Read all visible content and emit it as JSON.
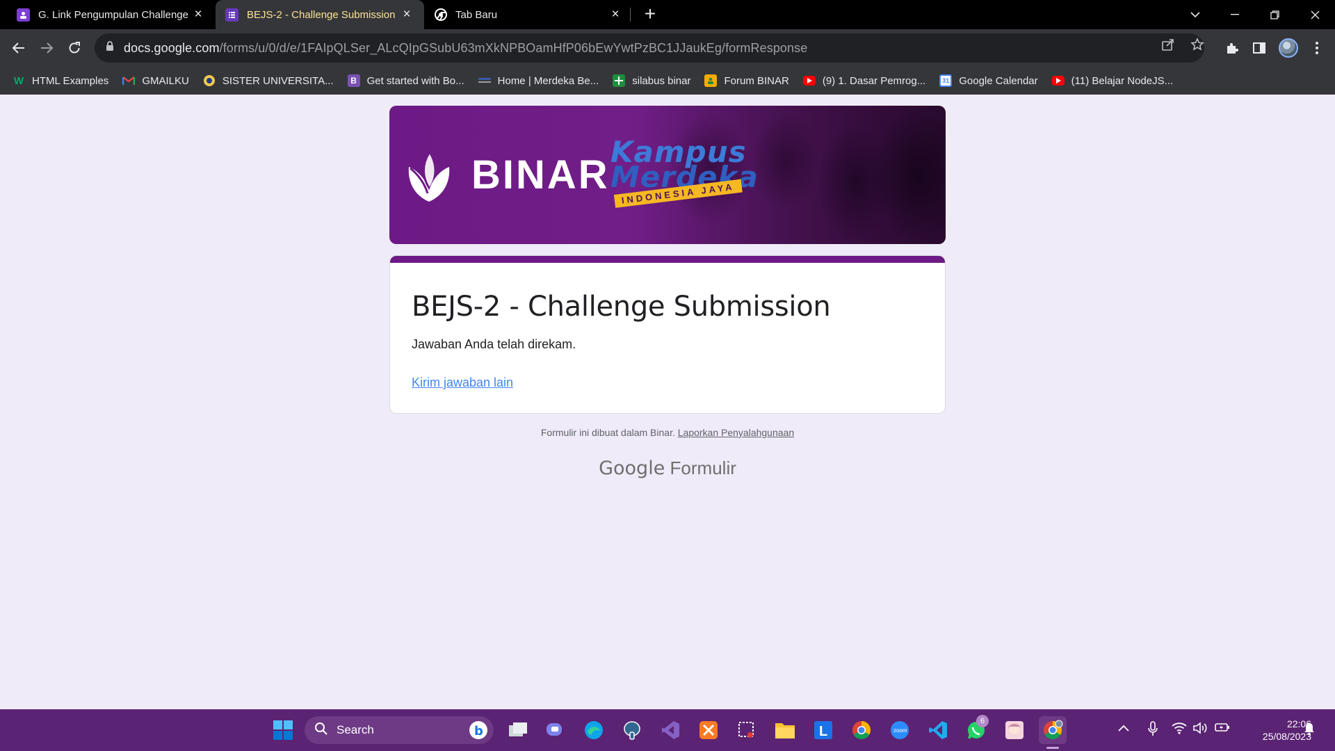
{
  "browser": {
    "tabs": [
      {
        "title": "G. Link Pengumpulan Challenge",
        "favicon": "classroom-icon",
        "color": "#7b3fd1"
      },
      {
        "title": "BEJS-2 - Challenge Submission",
        "favicon": "forms-icon",
        "color": "#673ab7",
        "active": true
      },
      {
        "title": "Tab Baru",
        "favicon": "chrome-icon",
        "color": "#ffffff"
      }
    ],
    "url_host": "docs.google.com",
    "url_path": "/forms/u/0/d/e/1FAIpQLSer_ALcQIpGSubU63mXkNPBOamHfP06bEwYwtPzBC1JJaukEg/formResponse"
  },
  "bookmarks": [
    {
      "label": "HTML Examples",
      "icon": "w3schools-icon",
      "color": "#04aa6d"
    },
    {
      "label": "GMAILKU",
      "icon": "gmail-icon",
      "color": "#ea4335"
    },
    {
      "label": "SISTER UNIVERSITA...",
      "icon": "university-icon",
      "color": "#f2c94c"
    },
    {
      "label": "Get started with Bo...",
      "icon": "bootstrap-icon",
      "color": "#7952b3"
    },
    {
      "label": "Home | Merdeka Be...",
      "icon": "merdeka-icon",
      "color": "#3a5ba8"
    },
    {
      "label": "silabus binar",
      "icon": "sheets-icon",
      "color": "#1e8e3e"
    },
    {
      "label": "Forum BINAR",
      "icon": "classroom-icon",
      "color": "#f9ab00"
    },
    {
      "label": "(9) 1. Dasar Pemrog...",
      "icon": "youtube-icon",
      "color": "#ff0000"
    },
    {
      "label": "Google Calendar",
      "icon": "calendar-icon",
      "color": "#4285f4"
    },
    {
      "label": "(11) Belajar NodeJS...",
      "icon": "youtube-icon",
      "color": "#ff0000"
    }
  ],
  "banner": {
    "brand": "BINAR",
    "campaign_line1": "Kampus",
    "campaign_line2": "Merdeka",
    "campaign_ribbon": "INDONESIA JAYA"
  },
  "form": {
    "title": "BEJS-2 - Challenge Submission",
    "confirmation": "Jawaban Anda telah direkam.",
    "another_response_link": "Kirim jawaban lain",
    "accent_color": "#6d1a86"
  },
  "footer": {
    "note": "Formulir ini dibuat dalam Binar.",
    "report_link": "Laporkan Penyalahgunaan",
    "logo_google": "Google",
    "logo_product": "Formulir"
  },
  "taskbar": {
    "search_placeholder": "Search",
    "whatsapp_badge": "6",
    "time": "22:06",
    "date": "25/08/2023"
  }
}
